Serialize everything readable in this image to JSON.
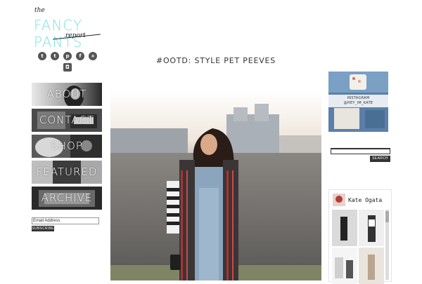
{
  "logo": {
    "the": "the",
    "main": "FANCY PANTS",
    "report": "report"
  },
  "social": {
    "icons": [
      {
        "name": "twitter-icon",
        "glyph": "t"
      },
      {
        "name": "tumblr-icon",
        "glyph": "t"
      },
      {
        "name": "pinterest-icon",
        "glyph": "p"
      },
      {
        "name": "facebook-icon",
        "glyph": "f"
      },
      {
        "name": "bloglovin-icon",
        "glyph": "+"
      },
      {
        "name": "instagram-icon",
        "glyph": "◘"
      }
    ]
  },
  "nav": {
    "items": [
      "ABOUT",
      "CONTACT",
      "SHOP",
      "FEATURED",
      "ARCHIVE"
    ]
  },
  "subscribe": {
    "email_value": "Email Address",
    "button_label": "SUBSCRIBE"
  },
  "post": {
    "title": "#OOTD: STYLE PET PEEVES"
  },
  "sidebar": {
    "instagram_label_line1": "INSTAGRAM",
    "instagram_label_line2": "@HEY_IM_KATE",
    "search_button": "SEARCH",
    "profile_name": "Kate Ogata"
  },
  "colors": {
    "logo_accent": "#7fe3e0",
    "dark_button": "#333333",
    "icon_bg": "#555555"
  }
}
